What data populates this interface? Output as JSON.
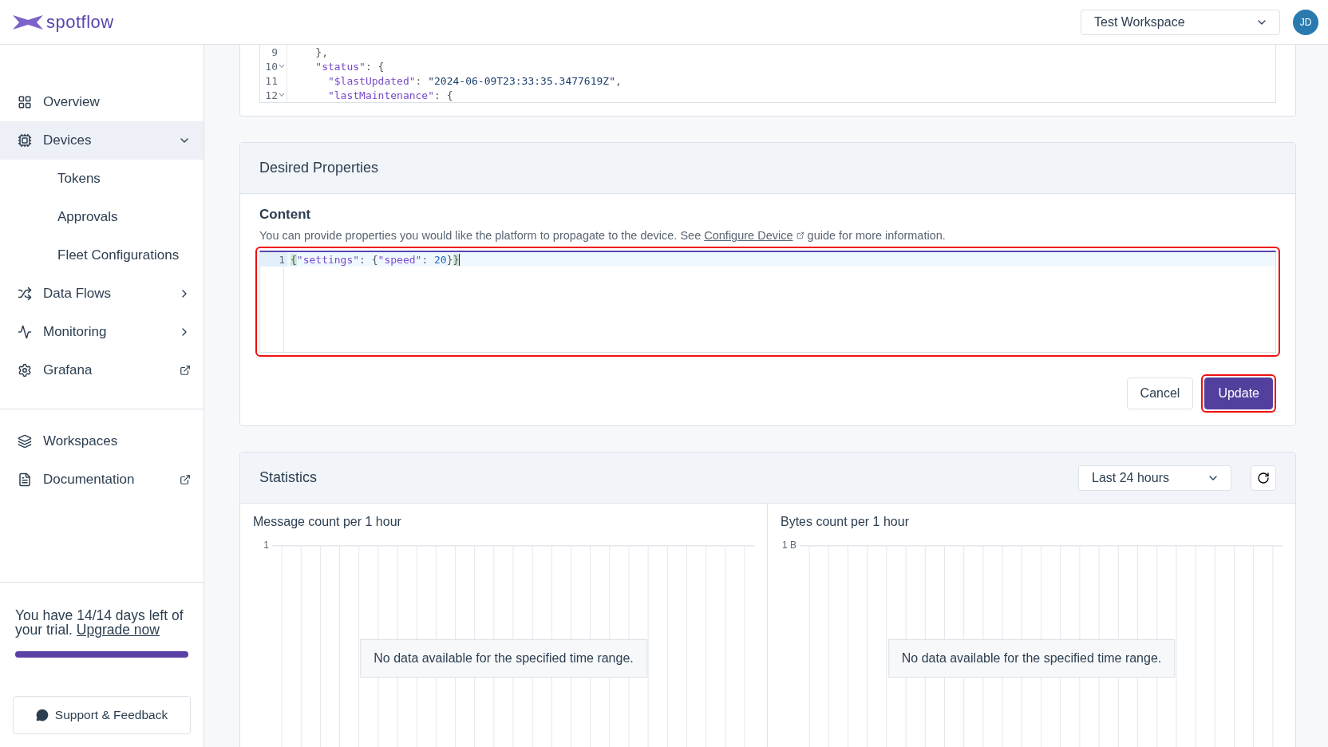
{
  "header": {
    "logo": "spotflow",
    "workspace": "Test Workspace",
    "avatar": "JD"
  },
  "sidebar": {
    "items": [
      {
        "label": "Overview",
        "kind": "link",
        "selected": false
      },
      {
        "label": "Devices",
        "kind": "expandable",
        "selected": true,
        "expanded": true,
        "children": [
          {
            "label": "Tokens",
            "selected": false
          },
          {
            "label": "Approvals",
            "selected": false
          },
          {
            "label": "Fleet Configurations",
            "selected": false
          }
        ]
      },
      {
        "label": "Data Flows",
        "kind": "expandable",
        "selected": false,
        "expanded": false
      },
      {
        "label": "Monitoring",
        "kind": "expandable",
        "selected": false,
        "expanded": false
      },
      {
        "label": "Grafana",
        "kind": "external",
        "selected": false
      }
    ],
    "secondary_items": [
      {
        "label": "Workspaces",
        "kind": "link",
        "selected": false
      },
      {
        "label": "Documentation",
        "kind": "external",
        "selected": false
      }
    ],
    "trial": {
      "text": "You have 14/14 days left of your trial.",
      "link": "Upgrade now",
      "level": 1
    },
    "support_button": "Support & Feedback"
  },
  "reported_editor": {
    "lines": [
      {
        "number": "9",
        "foldable": false,
        "tokens": [
          {
            "kind": "punct",
            "text": "    },"
          }
        ]
      },
      {
        "number": "10",
        "foldable": true,
        "tokens": [
          {
            "kind": "key",
            "text": "    \"status\""
          },
          {
            "kind": "punct",
            "text": ": {"
          }
        ]
      },
      {
        "number": "11",
        "foldable": false,
        "tokens": [
          {
            "kind": "key",
            "text": "      \"$lastUpdated\""
          },
          {
            "kind": "punct",
            "text": ": "
          },
          {
            "kind": "string",
            "text": "\"2024-06-09T23:33:35.3477619Z\""
          },
          {
            "kind": "punct",
            "text": ","
          }
        ]
      },
      {
        "number": "12",
        "foldable": true,
        "tokens": [
          {
            "kind": "key",
            "text": "      \"lastMaintenance\""
          },
          {
            "kind": "punct",
            "text": ": {"
          }
        ]
      }
    ]
  },
  "desired_properties": {
    "title": "Desired Properties",
    "content_label": "Content",
    "description": {
      "before": "You can provide properties you would like the platform to propagate to the device. See",
      "link": "Configure Device",
      "after": "guide for more information."
    },
    "editor": {
      "highlighted": true,
      "lines": [
        {
          "number": "1",
          "active": true,
          "tokens": [
            {
              "kind": "bracket",
              "text": "{"
            },
            {
              "kind": "key",
              "text": "\"settings\""
            },
            {
              "kind": "punct",
              "text": ": {"
            },
            {
              "kind": "key",
              "text": "\"speed\""
            },
            {
              "kind": "punct",
              "text": ": "
            },
            {
              "kind": "number",
              "text": "20"
            },
            {
              "kind": "punct",
              "text": "}"
            },
            {
              "kind": "bracket",
              "text": "}"
            }
          ]
        }
      ]
    },
    "buttons": [
      {
        "label": "Cancel",
        "kind": "secondary",
        "highlighted": false
      },
      {
        "label": "Update",
        "kind": "primary",
        "highlighted": true
      }
    ]
  },
  "statistics": {
    "title": "Statistics",
    "range": "Last 24 hours",
    "charts": [
      {
        "title": "Message count per 1 hour",
        "y_tick": "1",
        "message": "No data available for the specified time range."
      },
      {
        "title": "Bytes count per 1 hour",
        "y_tick": "1 B",
        "message": "No data available for the specified time range."
      }
    ]
  }
}
